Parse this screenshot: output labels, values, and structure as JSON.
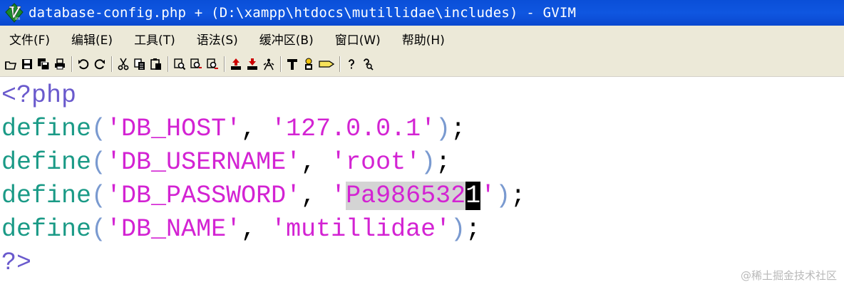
{
  "window": {
    "title": "database-config.php + (D:\\xampp\\htdocs\\mutillidae\\includes) - GVIM",
    "app_icon": "vim-logo"
  },
  "menu": {
    "items": [
      {
        "label": "文件(F)"
      },
      {
        "label": "编辑(E)"
      },
      {
        "label": "工具(T)"
      },
      {
        "label": "语法(S)"
      },
      {
        "label": "缓冲区(B)"
      },
      {
        "label": "窗口(W)"
      },
      {
        "label": "帮助(H)"
      }
    ]
  },
  "toolbar": {
    "groups": [
      [
        "open-icon",
        "save-icon",
        "save-all-icon",
        "print-icon"
      ],
      [
        "undo-icon",
        "redo-icon"
      ],
      [
        "cut-icon",
        "copy-icon",
        "paste-icon"
      ],
      [
        "find-replace-icon",
        "find-next-icon",
        "find-prev-icon"
      ],
      [
        "load-session-icon",
        "save-session-icon",
        "run-script-icon"
      ],
      [
        "make-icon",
        "shell-icon",
        "tag-jump-icon"
      ],
      [
        "help-icon",
        "find-help-icon"
      ]
    ]
  },
  "editor": {
    "lines": [
      {
        "open": "<?php"
      },
      {
        "fn": "define",
        "lp": "(",
        "k": "'DB_HOST'",
        "sep": ", ",
        "v": "'127.0.0.1'",
        "rp": ")",
        "end": ";"
      },
      {
        "fn": "define",
        "lp": "(",
        "k": "'DB_USERNAME'",
        "sep": ", ",
        "v": "'root'",
        "rp": ")",
        "end": ";"
      },
      {
        "fn": "define",
        "lp": "(",
        "k": "'DB_PASSWORD'",
        "sep": ", ",
        "v_quote": "'",
        "v_selected": "Pa986532",
        "v_cursor": "1",
        "v_close": "'",
        "rp": ")",
        "end": ";"
      },
      {
        "fn": "define",
        "lp": "(",
        "k": "'DB_NAME'",
        "sep": ", ",
        "v": "'mutillidae'",
        "rp": ")",
        "end": ";"
      },
      {
        "close": "?>"
      }
    ]
  },
  "watermark": {
    "text": "@稀土掘金技术社区"
  },
  "colors": {
    "titlebar": "#0a4fd8",
    "chrome": "#ece9d8",
    "keyword": "#1a9a86",
    "string": "#d323d3",
    "paren": "#7a9ad0",
    "php_tag": "#6a5acd",
    "selection": "#d4d4d4",
    "cursor": "#000000"
  }
}
